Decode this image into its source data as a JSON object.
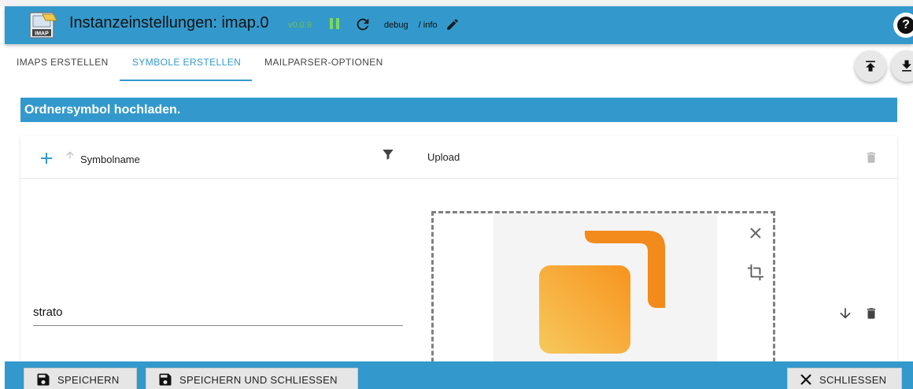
{
  "header": {
    "title": "Instanzeinstellungen: imap.0",
    "version": "v0.0.9",
    "log_level_label": "debug",
    "log_level_value": "/ info",
    "help_label": "?"
  },
  "tabs": [
    {
      "label": "IMAPS ERSTELLEN"
    },
    {
      "label": "SYMBOLE ERSTELLEN"
    },
    {
      "label": "MAILPARSER-OPTIONEN"
    }
  ],
  "section": {
    "title": "Ordnersymbol hochladen."
  },
  "table": {
    "columns": [
      "Symbolname",
      "Upload"
    ],
    "rows": [
      {
        "name": "strato"
      }
    ]
  },
  "footer": {
    "save_label": "SPEICHERN",
    "save_close_label": "SPEICHERN UND SCHLIESSEN",
    "close_label": "SCHLIESSEN"
  },
  "colors": {
    "accent": "#3399cc",
    "running": "#7ed957",
    "version": "#6dc24a",
    "logo_orange": "#f7931e"
  },
  "icons": [
    "imap-logo-icon",
    "pause-icon",
    "reload-icon",
    "edit-icon",
    "help-icon",
    "upload-icon",
    "download-icon",
    "add-icon",
    "sort-icon",
    "filter-icon",
    "delete-icon",
    "close-icon",
    "crop-icon",
    "arrow-down-icon",
    "save-icon"
  ]
}
